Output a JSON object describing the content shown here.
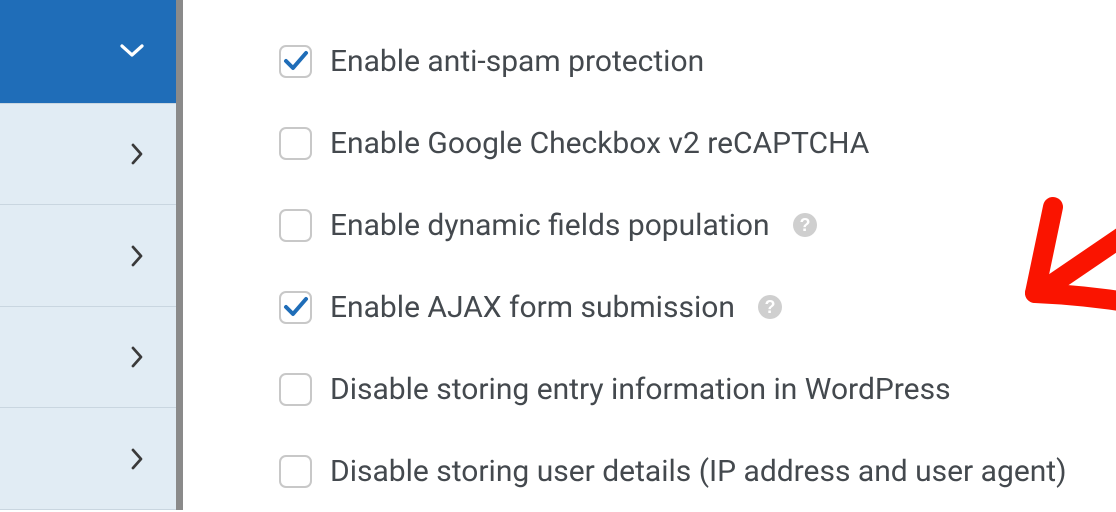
{
  "options": [
    {
      "label": "Enable anti-spam protection",
      "checked": true,
      "help": false
    },
    {
      "label": "Enable Google Checkbox v2 reCAPTCHA",
      "checked": false,
      "help": false
    },
    {
      "label": "Enable dynamic fields population",
      "checked": false,
      "help": true
    },
    {
      "label": "Enable AJAX form submission",
      "checked": true,
      "help": true
    },
    {
      "label": "Disable storing entry information in WordPress",
      "checked": false,
      "help": false
    },
    {
      "label": "Disable storing user details (IP address and user agent)",
      "checked": false,
      "help": false
    }
  ]
}
